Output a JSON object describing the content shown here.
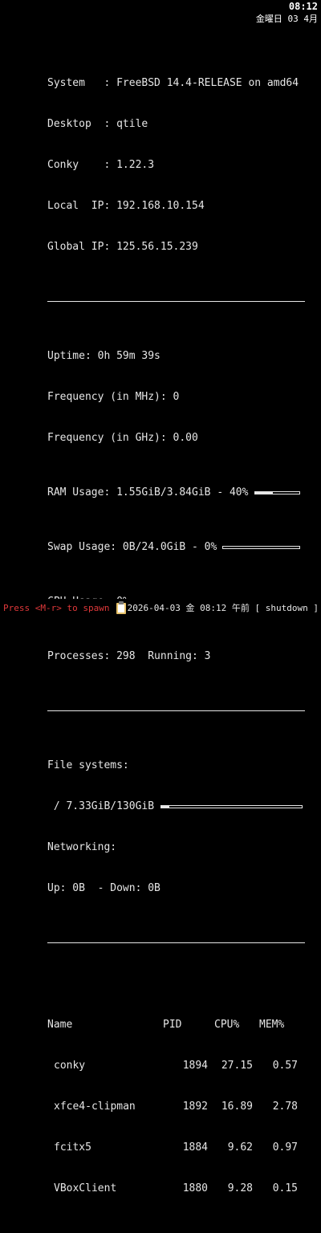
{
  "topbar": {
    "time": "08:12",
    "date": "金曜日 03 4月"
  },
  "conky": {
    "system": "System   : FreeBSD 14.4-RELEASE on amd64",
    "desktop": "Desktop  : qtile",
    "conky": "Conky    : 1.22.3",
    "local_ip": "Local  IP: 192.168.10.154",
    "global_ip": "Global IP: 125.56.15.239",
    "uptime": "Uptime: 0h 59m 39s",
    "freq_mhz": "Frequency (in MHz): 0",
    "freq_ghz": "Frequency (in GHz): 0.00",
    "ram": "RAM Usage: 1.55GiB/3.84GiB - 40%",
    "ram_pct": 40,
    "swap": "Swap Usage: 0B/24.0GiB - 0%",
    "swap_pct": 0,
    "cpu": "CPU Usage: 0%",
    "cpu_pct": 0,
    "processes": "Processes: 298  Running: 3",
    "fs_label": "File systems:",
    "fs_root": " / 7.33GiB/130GiB",
    "fs_pct": 5.6,
    "net_label": "Networking:",
    "net": "Up: 0B  - Down: 0B"
  },
  "process_table": {
    "headers": {
      "name": "Name",
      "pid": "PID",
      "cpu": "CPU%",
      "mem": "MEM%"
    },
    "rows": [
      {
        "name": "conky",
        "pid": "1894",
        "cpu": "27.15",
        "mem": "0.57"
      },
      {
        "name": "xfce4-clipman",
        "pid": "1892",
        "cpu": "16.89",
        "mem": "2.78"
      },
      {
        "name": "fcitx5",
        "pid": "1884",
        "cpu": "9.62",
        "mem": "0.97"
      },
      {
        "name": "VBoxClient",
        "pid": "1880",
        "cpu": "9.28",
        "mem": "0.15"
      }
    ]
  },
  "statusbar": {
    "prompt": "Press <M-r> to spawn",
    "clock": "2026-04-03 金 08:12 午前",
    "shutdown": "[ shutdown ]"
  },
  "icons": {
    "clipboard": "clipboard-icon"
  },
  "colors": {
    "background": "#000000",
    "text": "#e6e6e6",
    "prompt": "#e0383a"
  }
}
